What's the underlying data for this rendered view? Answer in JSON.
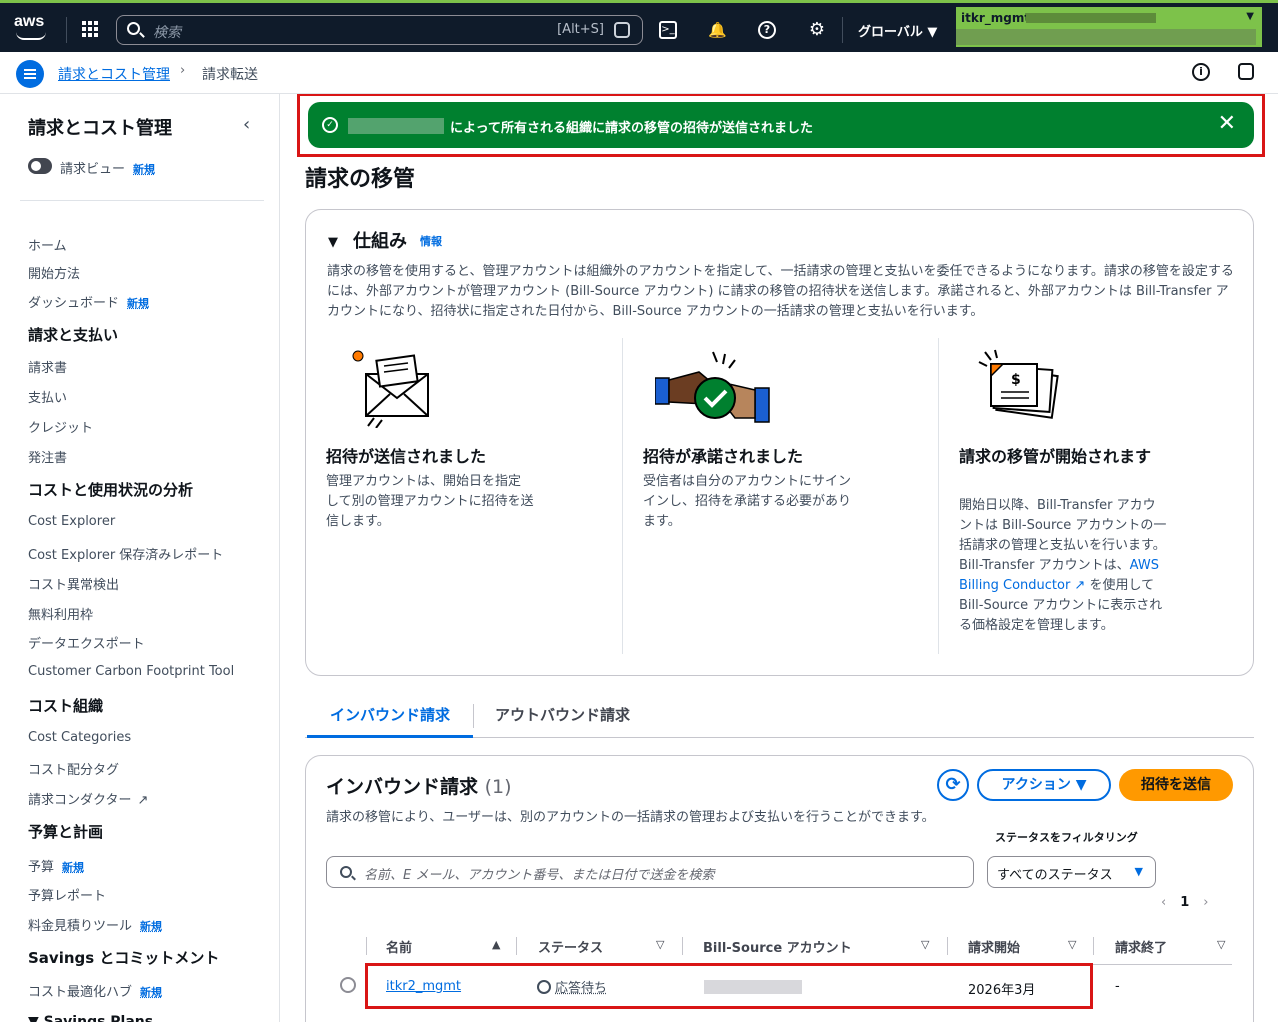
{
  "topnav": {
    "logo": "aws",
    "search_placeholder": "検索",
    "search_shortcut": "[Alt+S]",
    "region": "グローバル ▼",
    "account": "itkr_mgmt",
    "icons": [
      "grid-icon",
      "terminal-icon",
      "bell-icon",
      "help-icon",
      "gear-icon"
    ]
  },
  "breadcrumb": {
    "parent": "請求とコスト管理",
    "current": "請求転送"
  },
  "sidebar": {
    "title": "請求とコスト管理",
    "billing_view": "請求ビュー",
    "new": "新規",
    "items": [
      {
        "label": "ホーム"
      },
      {
        "label": "開始方法"
      },
      {
        "label": "ダッシュボード",
        "new": "新規"
      },
      {
        "section": "請求と支払い"
      },
      {
        "label": "請求書"
      },
      {
        "label": "支払い"
      },
      {
        "label": "クレジット"
      },
      {
        "label": "発注書"
      },
      {
        "section": "コストと使用状況の分析"
      },
      {
        "label": "Cost Explorer"
      },
      {
        "label": "Cost Explorer 保存済みレポート"
      },
      {
        "label": "コスト異常検出"
      },
      {
        "label": "無料利用枠"
      },
      {
        "label": "データエクスポート"
      },
      {
        "label": "Customer Carbon Footprint Tool"
      },
      {
        "section": "コスト組織"
      },
      {
        "label": "Cost Categories"
      },
      {
        "label": "コスト配分タグ"
      },
      {
        "label": "請求コンダクター"
      },
      {
        "section": "予算と計画"
      },
      {
        "label": "予算",
        "new": "新規"
      },
      {
        "label": "予算レポート"
      },
      {
        "label": "料金見積りツール",
        "new": "新規"
      },
      {
        "section": "Savings とコミットメント"
      },
      {
        "label": "コスト最適化ハブ",
        "new": "新規"
      },
      {
        "label": "Savings Plans"
      }
    ]
  },
  "flash": {
    "message": "によって所有される組織に請求の移管の招待が送信されました"
  },
  "page_title": "請求の移管",
  "how": {
    "title": "仕組み",
    "info": "情報",
    "description": "請求の移管を使用すると、管理アカウントは組織外のアカウントを指定して、一括請求の管理と支払いを委任できるようになります。請求の移管を設定するには、外部アカウントが管理アカウント (Bill-Source アカウント) に請求の移管の招待状を送信します。承諾されると、外部アカウントは Bill-Transfer アカウントになり、招待状に指定された日付から、Bill-Source アカウントの一括請求の管理と支払いを行います。",
    "steps": [
      {
        "title": "招待が送信されました",
        "text": "管理アカウントは、開始日を指定して別の管理アカウントに招待を送信します。"
      },
      {
        "title": "招待が承諾されました",
        "text": "受信者は自分のアカウントにサインインし、招待を承諾する必要があります。"
      },
      {
        "title": "請求の移管が開始されます",
        "text_a": "開始日以降、Bill-Transfer アカウントは Bill-Source アカウントの一括請求の管理と支払いを行います。Bill-Transfer アカウントは、",
        "link": "AWS Billing Conductor",
        "text_b": "を使用して Bill-Source アカウントに表示される価格設定を管理します。"
      }
    ]
  },
  "tabs": [
    "インバウンド請求",
    "アウトバウンド請求"
  ],
  "inbound": {
    "title": "インバウンド請求",
    "count": "(1)",
    "actions": "アクション",
    "send_invite": "招待を送信",
    "subtitle": "請求の移管により、ユーザーは、別のアカウントの一括請求の管理および支払いを行うことができます。",
    "search_placeholder": "名前、E メール、アカウント番号、または日付で送金を検索",
    "filter_label": "ステータスをフィルタリング",
    "filter_value": "すべてのステータス",
    "page": "1",
    "columns": [
      "名前",
      "ステータス",
      "Bill-Source アカウント",
      "請求開始",
      "請求終了"
    ],
    "rows": [
      {
        "name": "itkr2_mgmt",
        "status": "応答待ち",
        "start": "2026年3月",
        "end": "-"
      }
    ]
  },
  "colors": {
    "brand_nav": "#0f1b2a",
    "account_bar": "#7dc24a",
    "success": "#00802f",
    "link": "#006ce0",
    "primary_button": "#ff9900",
    "highlight": "#d91515"
  }
}
